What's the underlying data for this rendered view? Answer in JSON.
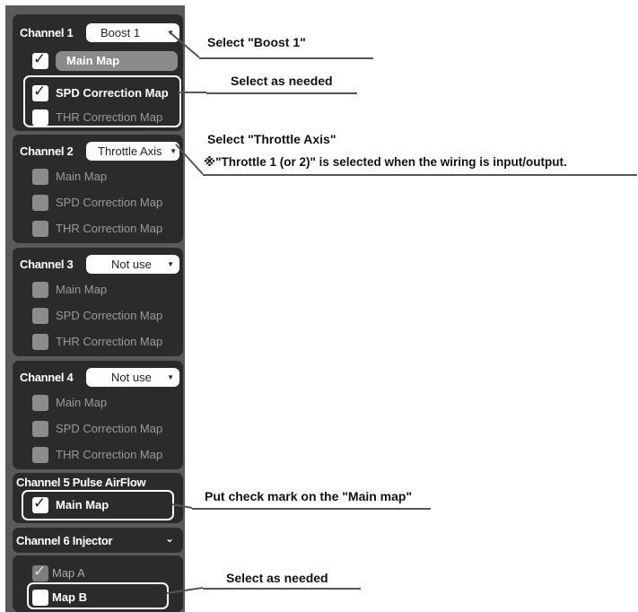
{
  "channels": [
    {
      "label": "Channel 1",
      "select": "Boost 1",
      "items": [
        {
          "label": "Main Map",
          "checked": true
        },
        {
          "label": "SPD Correction Map",
          "checked": true
        },
        {
          "label": "THR Correction Map",
          "checked": false
        }
      ]
    },
    {
      "label": "Channel 2",
      "select": "Throttle Axis",
      "items": [
        {
          "label": "Main Map",
          "checked": false
        },
        {
          "label": "SPD Correction Map",
          "checked": false
        },
        {
          "label": "THR Correction Map",
          "checked": false
        }
      ]
    },
    {
      "label": "Channel 3",
      "select": "Not use",
      "items": [
        {
          "label": "Main Map",
          "checked": false
        },
        {
          "label": "SPD Correction Map",
          "checked": false
        },
        {
          "label": "THR Correction Map",
          "checked": false
        }
      ]
    },
    {
      "label": "Channel 4",
      "select": "Not use",
      "items": [
        {
          "label": "Main Map",
          "checked": false
        },
        {
          "label": "SPD Correction Map",
          "checked": false
        },
        {
          "label": "THR Correction Map",
          "checked": false
        }
      ]
    },
    {
      "label": "Channel 5 Pulse AirFlow",
      "items": [
        {
          "label": "Main Map",
          "checked": true
        }
      ]
    },
    {
      "label": "Channel 6 Injector",
      "items": [
        {
          "label": "Map A",
          "checked": true
        },
        {
          "label": "Map B",
          "checked": false
        }
      ]
    }
  ],
  "annotations": {
    "select_boost": "Select \"Boost 1\"",
    "select_needed_1": "Select as needed",
    "select_throttle": "Select \"Throttle Axis\"",
    "throttle_note": "※\"Throttle 1 (or 2)\" is selected when the wiring is input/output.",
    "main_map_note": "Put check mark on the \"Main map\"",
    "select_needed_2": "Select as needed"
  },
  "colors": {
    "panel": "#5a5a5a",
    "card": "#2b2b2b",
    "accent_ring": "#ffffff",
    "line": "#555555"
  },
  "icons": {
    "dropdown": "chevron-down-icon",
    "check": "check-icon"
  }
}
